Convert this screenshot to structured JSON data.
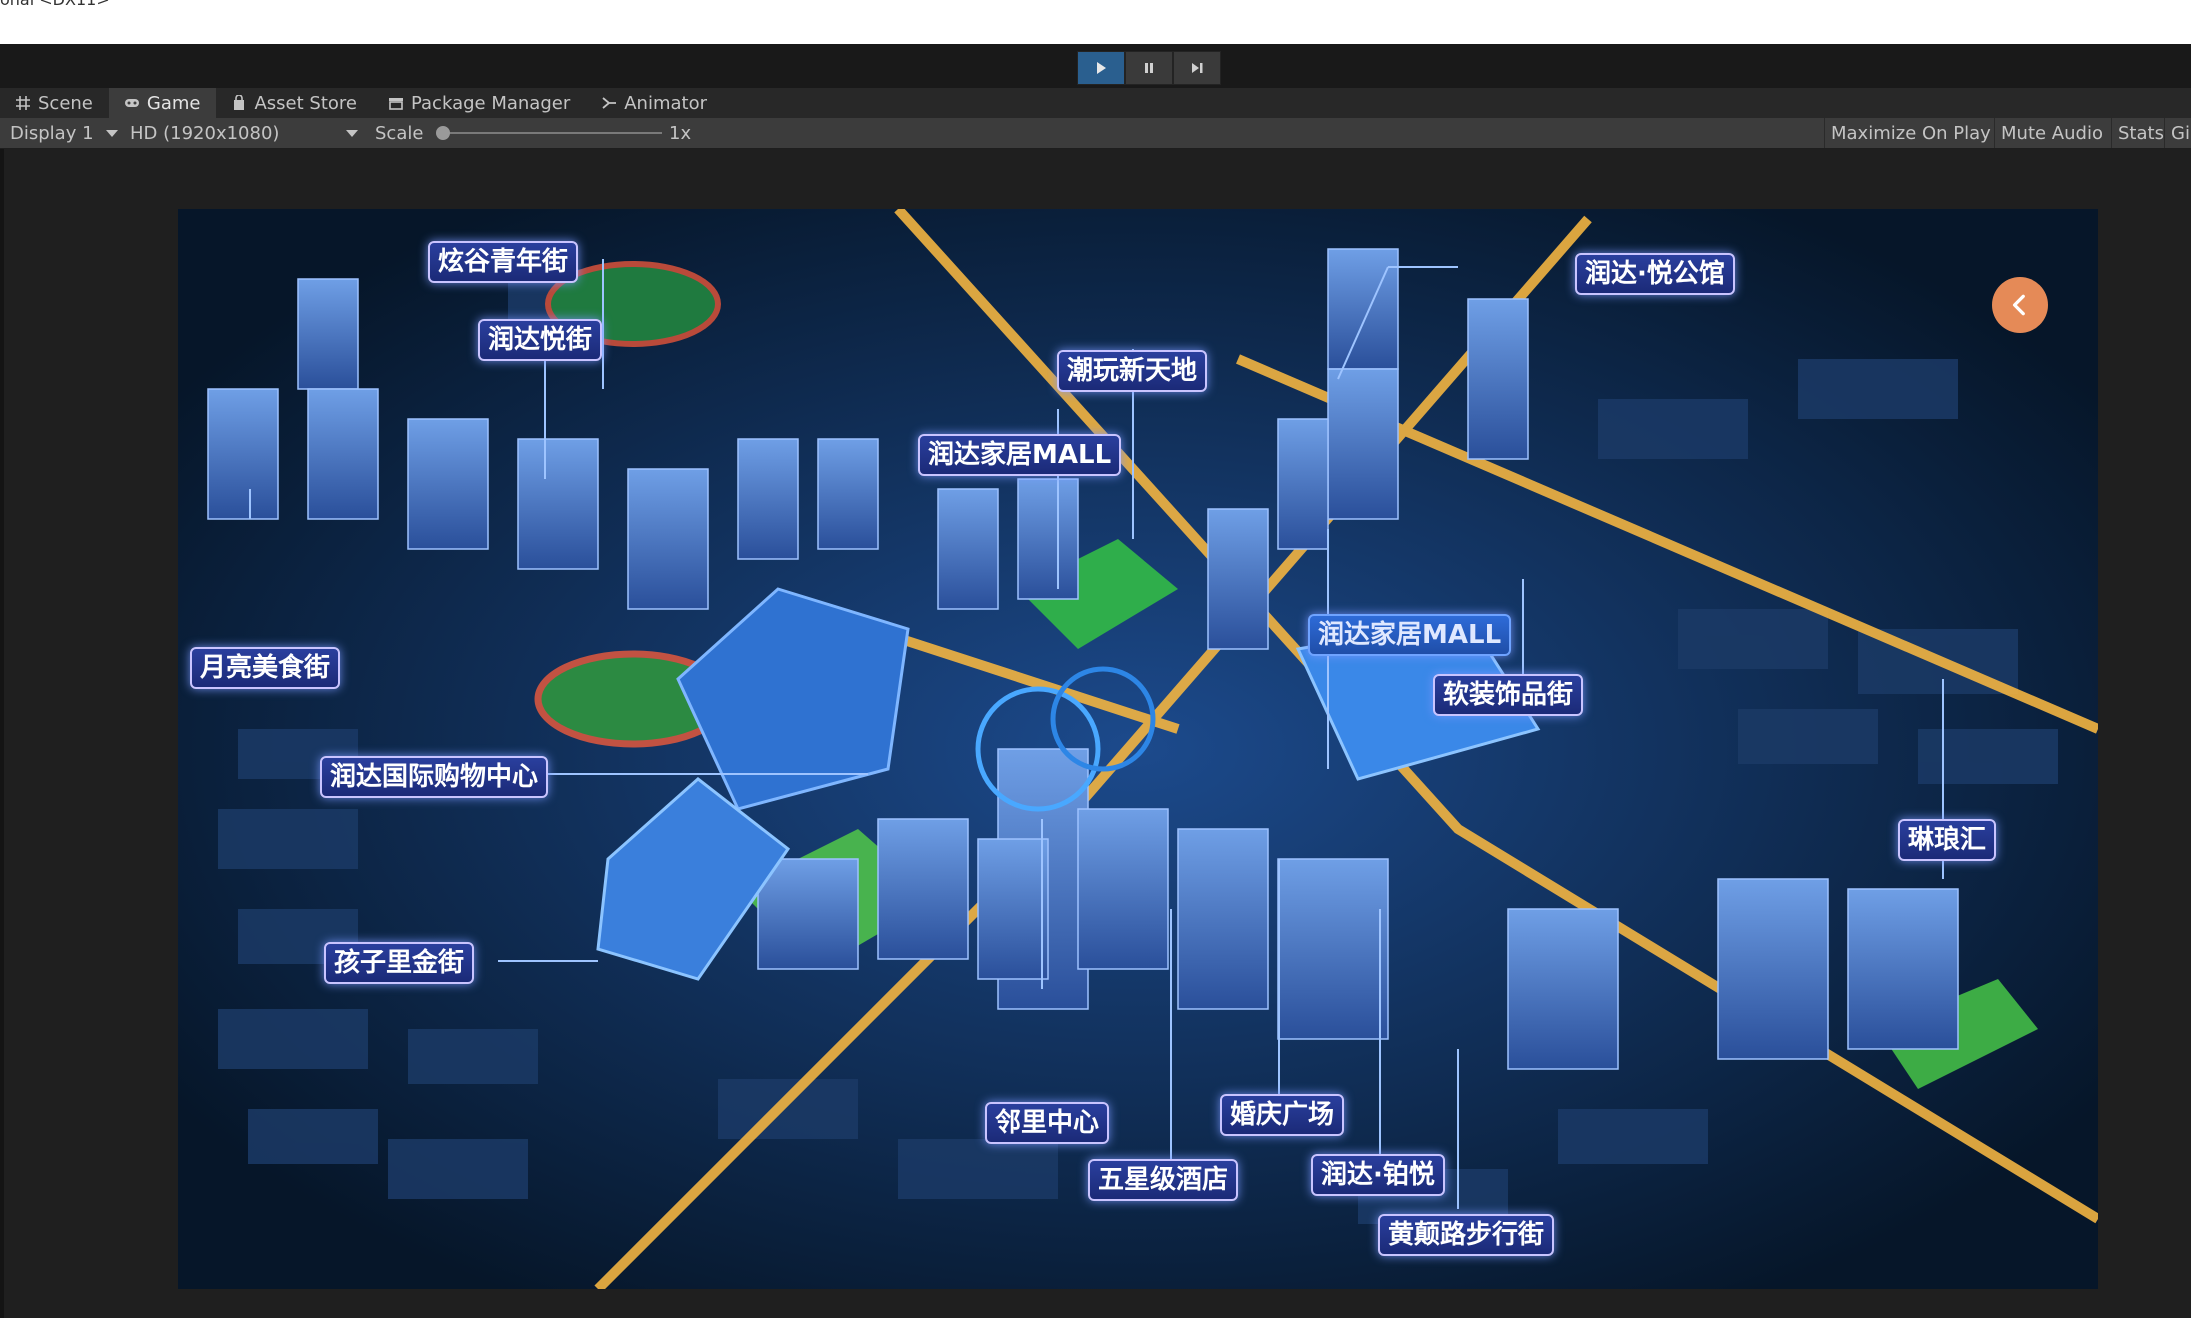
{
  "window": {
    "title_fragment": "onal <DX11>"
  },
  "toolbar": {
    "play_icon": "play-icon",
    "pause_icon": "pause-icon",
    "step_icon": "step-icon"
  },
  "tabs": [
    {
      "label": "Scene",
      "icon": "grid-icon"
    },
    {
      "label": "Game",
      "icon": "gamepad-icon"
    },
    {
      "label": "Asset Store",
      "icon": "bag-icon"
    },
    {
      "label": "Package Manager",
      "icon": "package-icon"
    },
    {
      "label": "Animator",
      "icon": "animator-icon"
    }
  ],
  "gamebar": {
    "display": "Display 1",
    "resolution": "HD (1920x1080)",
    "scale_label": "Scale",
    "scale_value": "1x",
    "scale_level": 0,
    "maximize": "Maximize On Play",
    "mute": "Mute Audio",
    "stats": "Stats",
    "gizmos": "Gi"
  },
  "scene": {
    "labels": {
      "xuangu": "炫谷青年街",
      "yuejie": "润达悦街",
      "yuegongguan": "润达·悦公馆",
      "chaowan": "潮玩新天地",
      "mall_top": "润达家居MALL",
      "mall_mid": "润达家居MALL",
      "ruanzhuang": "软装饰品街",
      "yueliang": "月亮美食街",
      "gouwu": "润达国际购物中心",
      "linlang": "琳琅汇",
      "haiziali": "孩子里金街",
      "linli": "邻里中心",
      "hunqing": "婚庆广场",
      "jiudian": "五星级酒店",
      "boyue": "润达·铂悦",
      "huangdian": "黄颠路步行街"
    },
    "back_icon": "chevron-left-icon"
  },
  "colors": {
    "accent_play": "#2a5f8f",
    "back_button": "#e58a57",
    "label_border": "#c9c4ff"
  }
}
